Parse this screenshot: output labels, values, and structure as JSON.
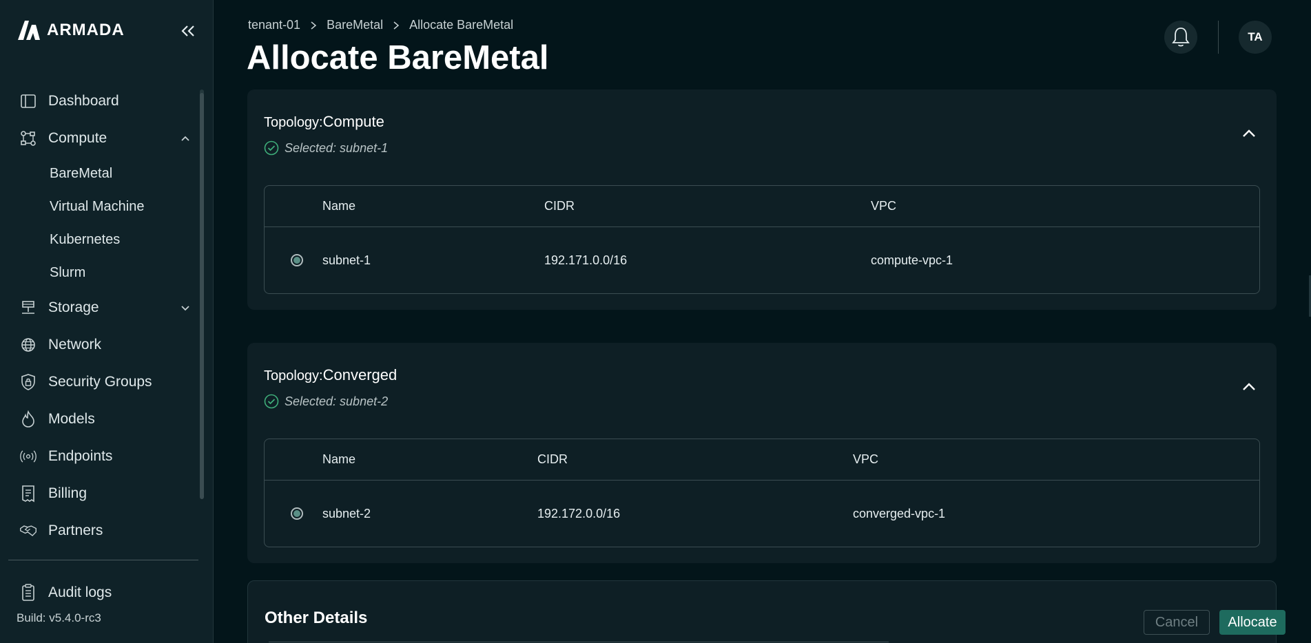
{
  "brand": {
    "name": "ARMADA"
  },
  "breadcrumb": {
    "items": [
      "tenant-01",
      "BareMetal",
      "Allocate BareMetal"
    ]
  },
  "page": {
    "title": "Allocate BareMetal"
  },
  "header": {
    "avatar_initials": "TA"
  },
  "sidebar": {
    "items": [
      {
        "label": "Dashboard",
        "icon": "dashboard-icon"
      },
      {
        "label": "Compute",
        "icon": "compute-icon",
        "expanded": true,
        "children": [
          "BareMetal",
          "Virtual Machine",
          "Kubernetes",
          "Slurm"
        ]
      },
      {
        "label": "Storage",
        "icon": "storage-icon",
        "expanded": false
      },
      {
        "label": "Network",
        "icon": "globe-icon"
      },
      {
        "label": "Security Groups",
        "icon": "shield-lock-icon"
      },
      {
        "label": "Models",
        "icon": "flame-icon"
      },
      {
        "label": "Endpoints",
        "icon": "broadcast-icon"
      },
      {
        "label": "Billing",
        "icon": "receipt-icon"
      },
      {
        "label": "Partners",
        "icon": "handshake-icon"
      }
    ],
    "audit_logs": {
      "label": "Audit logs",
      "icon": "clipboard-icon"
    },
    "build": "Build: v5.4.0-rc3"
  },
  "topologies": [
    {
      "label": "Topology:",
      "name": "Compute",
      "selected_text": "Selected: subnet-1",
      "columns": [
        "Name",
        "CIDR",
        "VPC"
      ],
      "rows": [
        {
          "name": "subnet-1",
          "cidr": "192.171.0.0/16",
          "vpc": "compute-vpc-1",
          "selected": true
        }
      ]
    },
    {
      "label": "Topology:",
      "name": "Converged",
      "selected_text": "Selected: subnet-2",
      "columns": [
        "Name",
        "CIDR",
        "VPC"
      ],
      "rows": [
        {
          "name": "subnet-2",
          "cidr": "192.172.0.0/16",
          "vpc": "converged-vpc-1",
          "selected": true
        }
      ]
    }
  ],
  "details": {
    "title": "Other Details"
  },
  "actions": {
    "cancel_label": "Cancel",
    "allocate_label": "Allocate"
  },
  "colors": {
    "accent": "#1e6b5e",
    "check": "#3fae7a",
    "background": "#03151a",
    "card": "#0e1f25",
    "sidebar": "#0f2228"
  }
}
